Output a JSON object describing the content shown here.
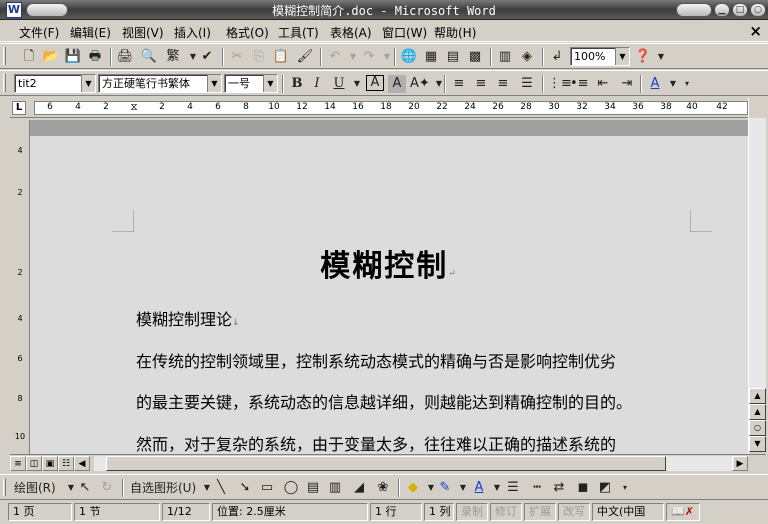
{
  "window": {
    "title": "模糊控制简介.doc - Microsoft Word",
    "app_icon": "W"
  },
  "menu": [
    "文件(F)",
    "编辑(E)",
    "视图(V)",
    "插入(I)",
    "格式(O)",
    "工具(T)",
    "表格(A)",
    "窗口(W)",
    "帮助(H)"
  ],
  "toolbar": {
    "zoom": "100%",
    "traditional": "繁"
  },
  "format": {
    "style": "tit2",
    "font": "方正硬笔行书繁体",
    "size": "一号"
  },
  "ruler": {
    "h_numbers": [
      "6",
      "4",
      "2",
      "2",
      "4",
      "6",
      "8",
      "10",
      "12",
      "14",
      "16",
      "18",
      "20",
      "22",
      "24",
      "26",
      "28",
      "30",
      "32",
      "34",
      "36",
      "38",
      "40",
      "42"
    ],
    "v_numbers": [
      "4",
      "2",
      "2",
      "4",
      "6",
      "8",
      "10"
    ]
  },
  "document": {
    "title": "模糊控制",
    "lines": [
      "模糊控制理论",
      "在传统的控制领域里，控制系统动态模式的精确与否是影响控制优劣",
      "的最主要关键，系统动态的信息越详细，则越能达到精确控制的目的。",
      "然而，对于复杂的系统，由于变量太多，往往难以正确的描述系统的"
    ]
  },
  "drawing": {
    "draw_label": "绘图(R)",
    "autoshape_label": "自选图形(U)"
  },
  "status": {
    "page": "1 页",
    "section": "1 节",
    "pages": "1/12",
    "position": "位置: 2.5厘米",
    "line": "1 行",
    "column": "1 列",
    "rec": "录制",
    "trk": "修订",
    "ext": "扩展",
    "ovr": "改写",
    "lang": "中文(中国"
  }
}
